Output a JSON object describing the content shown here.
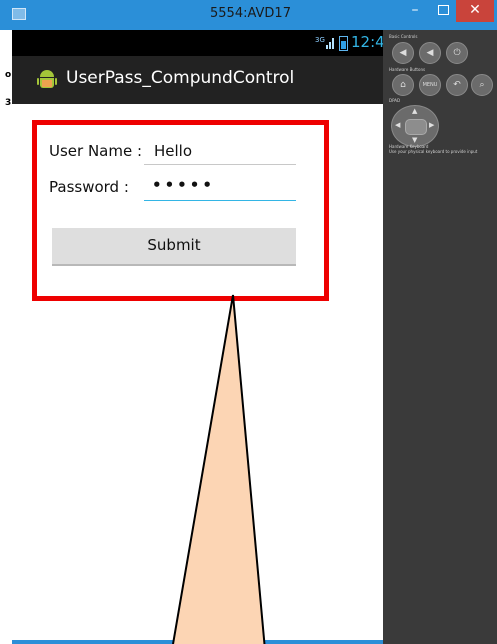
{
  "window": {
    "title": "5554:AVD17",
    "minimize_glyph": "–",
    "close_glyph": "✕",
    "left_strip_chars": [
      "o",
      "3"
    ],
    "colors": {
      "frame": "#2b8fd8",
      "close": "#c9443b"
    }
  },
  "device": {
    "status_bar": {
      "network": "3G",
      "time": "12:48"
    },
    "action_bar": {
      "title": "UserPass_CompundControl",
      "icon": "android-icon"
    },
    "form": {
      "username_label": "User Name :",
      "username_value": "Hello",
      "password_label": "Password :",
      "password_value": "•••••",
      "submit_label": "Submit",
      "highlight_color": "#ee0000"
    }
  },
  "callout": {
    "fill": "#fcd5b4",
    "stroke": "#000000"
  },
  "controls_panel": {
    "basic_controls_label": "Basic Controls",
    "hardware_buttons_label": "Hardware Buttons",
    "dpad_label": "DPAD",
    "keyboard_label_1": "Hardware Keyboard",
    "keyboard_label_2": "Use your physical keyboard to provide input",
    "menu_label": "MENU",
    "volume_down_icon": "volume-down-icon",
    "volume_up_icon": "volume-up-icon",
    "power_icon": "power-icon",
    "home_icon": "home-icon",
    "back_icon": "back-icon",
    "search_icon": "search-icon"
  }
}
